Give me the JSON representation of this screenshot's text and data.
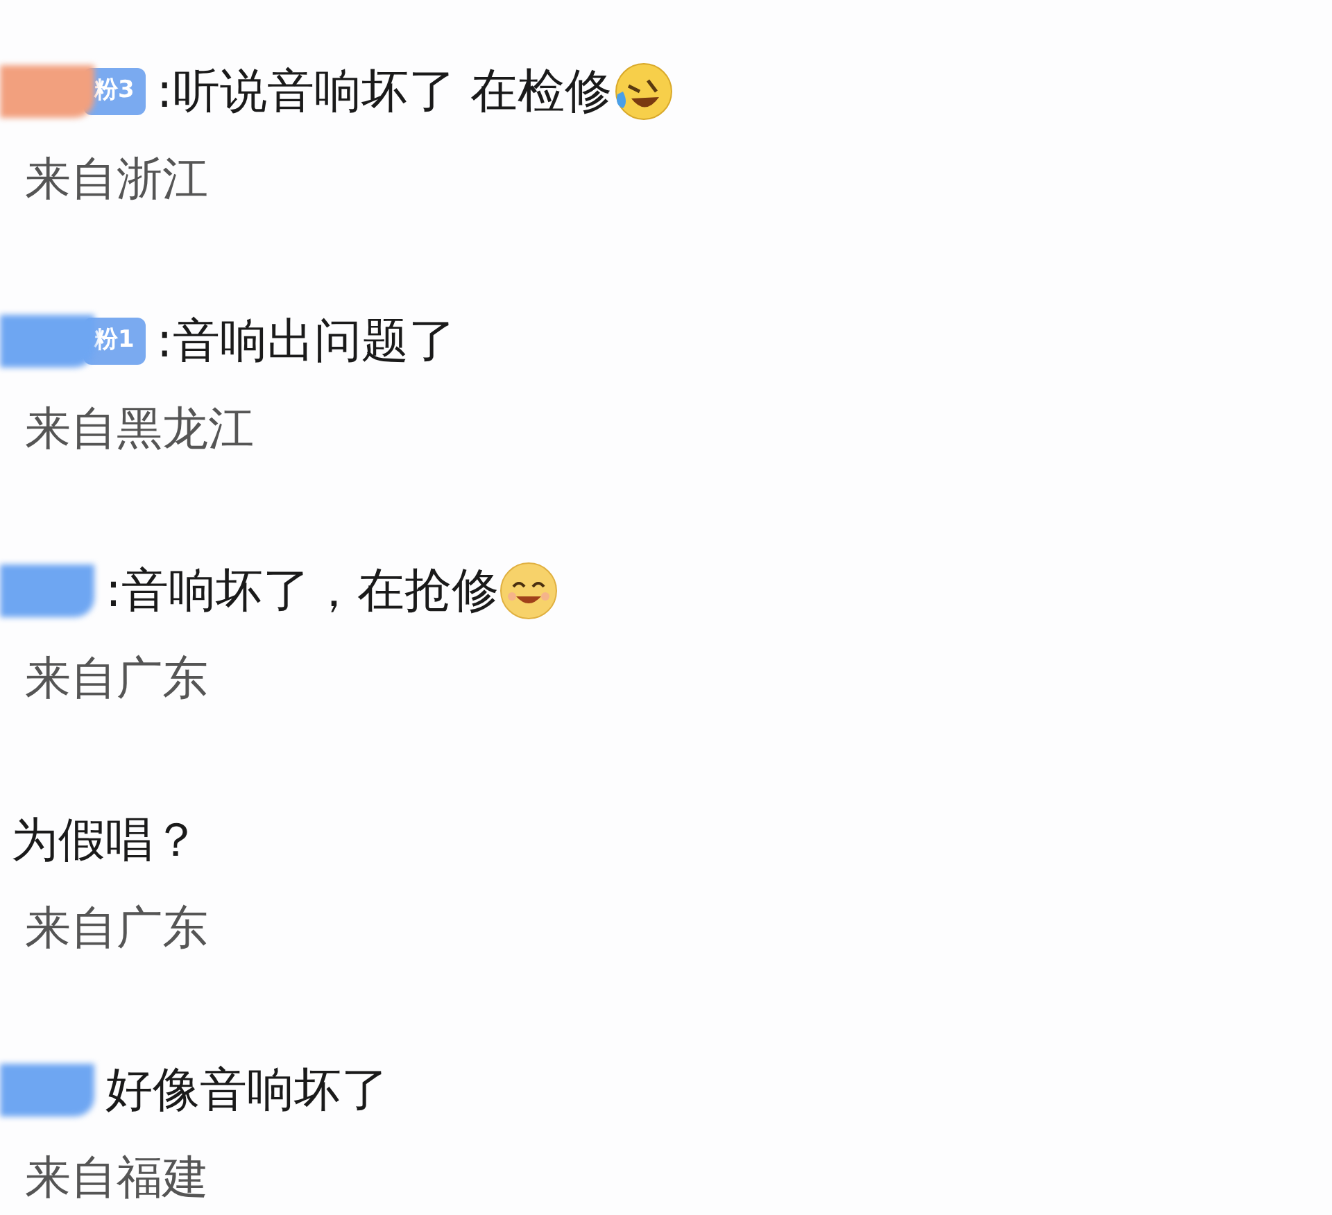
{
  "comments": [
    {
      "color": "#f2a07e",
      "badge": "粉3",
      "text": ":听说音响坏了 在检修",
      "emoji": {
        "kind": "laugh-cry"
      },
      "location": "来自浙江"
    },
    {
      "color": "#6ea6f2",
      "badge": "粉1",
      "text": ":音响出问题了",
      "location": "来自黑龙江"
    },
    {
      "color": "#6ea6f2",
      "text": ":音响坏了，在抢修",
      "emoji": {
        "kind": "smile"
      },
      "location": "来自广东"
    },
    {
      "text": "为假唱？",
      "location": "来自广东"
    },
    {
      "color": "#6ea6f2",
      "text": "好像音响坏了",
      "location": "来自福建"
    }
  ]
}
